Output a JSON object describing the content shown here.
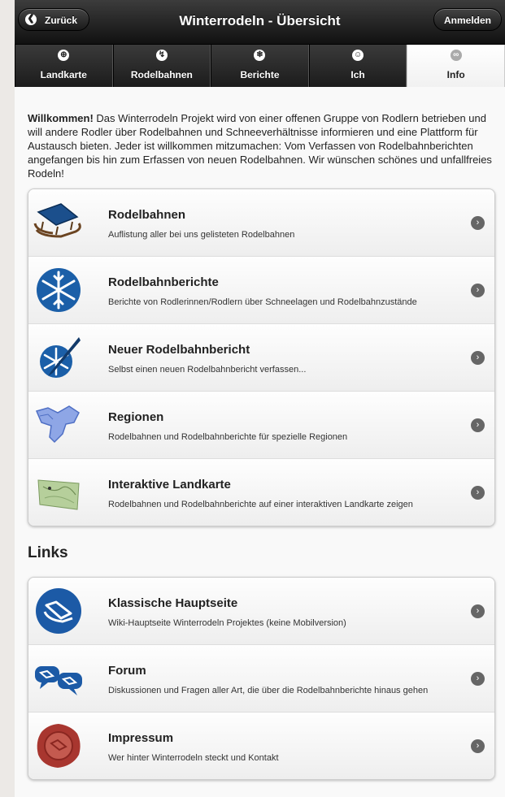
{
  "header": {
    "back_label": "Zurück",
    "title": "Winterrodeln - Übersicht",
    "login_label": "Anmelden"
  },
  "tabs": [
    {
      "label": "Landkarte",
      "icon": "globe-icon"
    },
    {
      "label": "Rodelbahnen",
      "icon": "sled-icon"
    },
    {
      "label": "Berichte",
      "icon": "snowflake-icon"
    },
    {
      "label": "Ich",
      "icon": "smiley-icon"
    },
    {
      "label": "Info",
      "icon": "info-icon",
      "active": true
    }
  ],
  "intro": {
    "bold": "Willkommen!",
    "text": " Das Winterrodeln Projekt wird von einer offenen Gruppe von Rodlern betrieben und will andere Rodler über Rodelbahnen und Schneeverhältnisse informieren und eine Plattform für Austausch bieten. Jeder ist willkommen mitzumachen: Vom Verfassen von Rodelbahnberichten angefangen bis hin zum Erfassen von neuen Rodelbahnen. Wir wünschen schönes und unfallfreies Rodeln!"
  },
  "main_list": [
    {
      "title": "Rodelbahnen",
      "desc": "Auflistung aller bei uns gelisteten Rodelbahnen",
      "icon": "sled-image"
    },
    {
      "title": "Rodelbahnberichte",
      "desc": "Berichte von Rodlerinnen/Rodlern über Schneelagen und Rodelbahnzustände",
      "icon": "snowflake-image"
    },
    {
      "title": "Neuer Rodelbahnbericht",
      "desc": "Selbst einen neuen Rodelbahnbericht verfassen...",
      "icon": "snowflake-pen-image"
    },
    {
      "title": "Regionen",
      "desc": "Rodelbahnen und Rodelbahnberichte für spezielle Regionen",
      "icon": "region-map-image"
    },
    {
      "title": "Interaktive Landkarte",
      "desc": "Rodelbahnen und Rodelbahnberichte auf einer interaktiven Landkarte zeigen",
      "icon": "paper-map-image"
    }
  ],
  "links_heading": "Links",
  "links_list": [
    {
      "title": "Klassische Hauptseite",
      "desc": "Wiki-Hauptseite Winterrodeln Projektes (keine Mobilversion)",
      "icon": "sled-circle-image"
    },
    {
      "title": "Forum",
      "desc": "Diskussionen und Fragen aller Art, die über die Rodelbahnberichte hinaus gehen",
      "icon": "speech-bubbles-image"
    },
    {
      "title": "Impressum",
      "desc": "Wer hinter Winterrodeln steckt und Kontakt",
      "icon": "wax-seal-image"
    }
  ],
  "colors": {
    "header_dark": "#1a1a1a",
    "accent_blue": "#1c5aa6"
  }
}
